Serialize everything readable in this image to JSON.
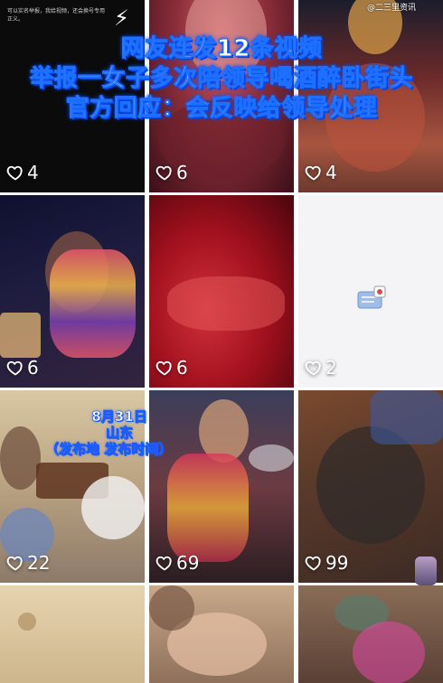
{
  "watermark": "@二三里资讯",
  "headline": {
    "line1": "网友连发12条视频",
    "line2": "举报一女子多次陪领导喝酒醉卧街头",
    "line3": "官方回应：会反映给领导处理"
  },
  "first_tile_text": "可以实名举报，我给视频，还会换号专用正义。",
  "overlay": {
    "date": "8月31日",
    "place": "山东",
    "note": "（发布地 发布时间）"
  },
  "videos": [
    {
      "likes": "4"
    },
    {
      "likes": "6"
    },
    {
      "likes": "4"
    },
    {
      "likes": "6"
    },
    {
      "likes": "6"
    },
    {
      "likes": "2"
    },
    {
      "likes": "22"
    },
    {
      "likes": "69"
    },
    {
      "likes": "99"
    },
    {
      "likes": ""
    },
    {
      "likes": ""
    },
    {
      "likes": ""
    }
  ],
  "icons": {
    "like": "heart-outline-icon",
    "bolt": "lightning-icon",
    "document": "document-icon"
  }
}
